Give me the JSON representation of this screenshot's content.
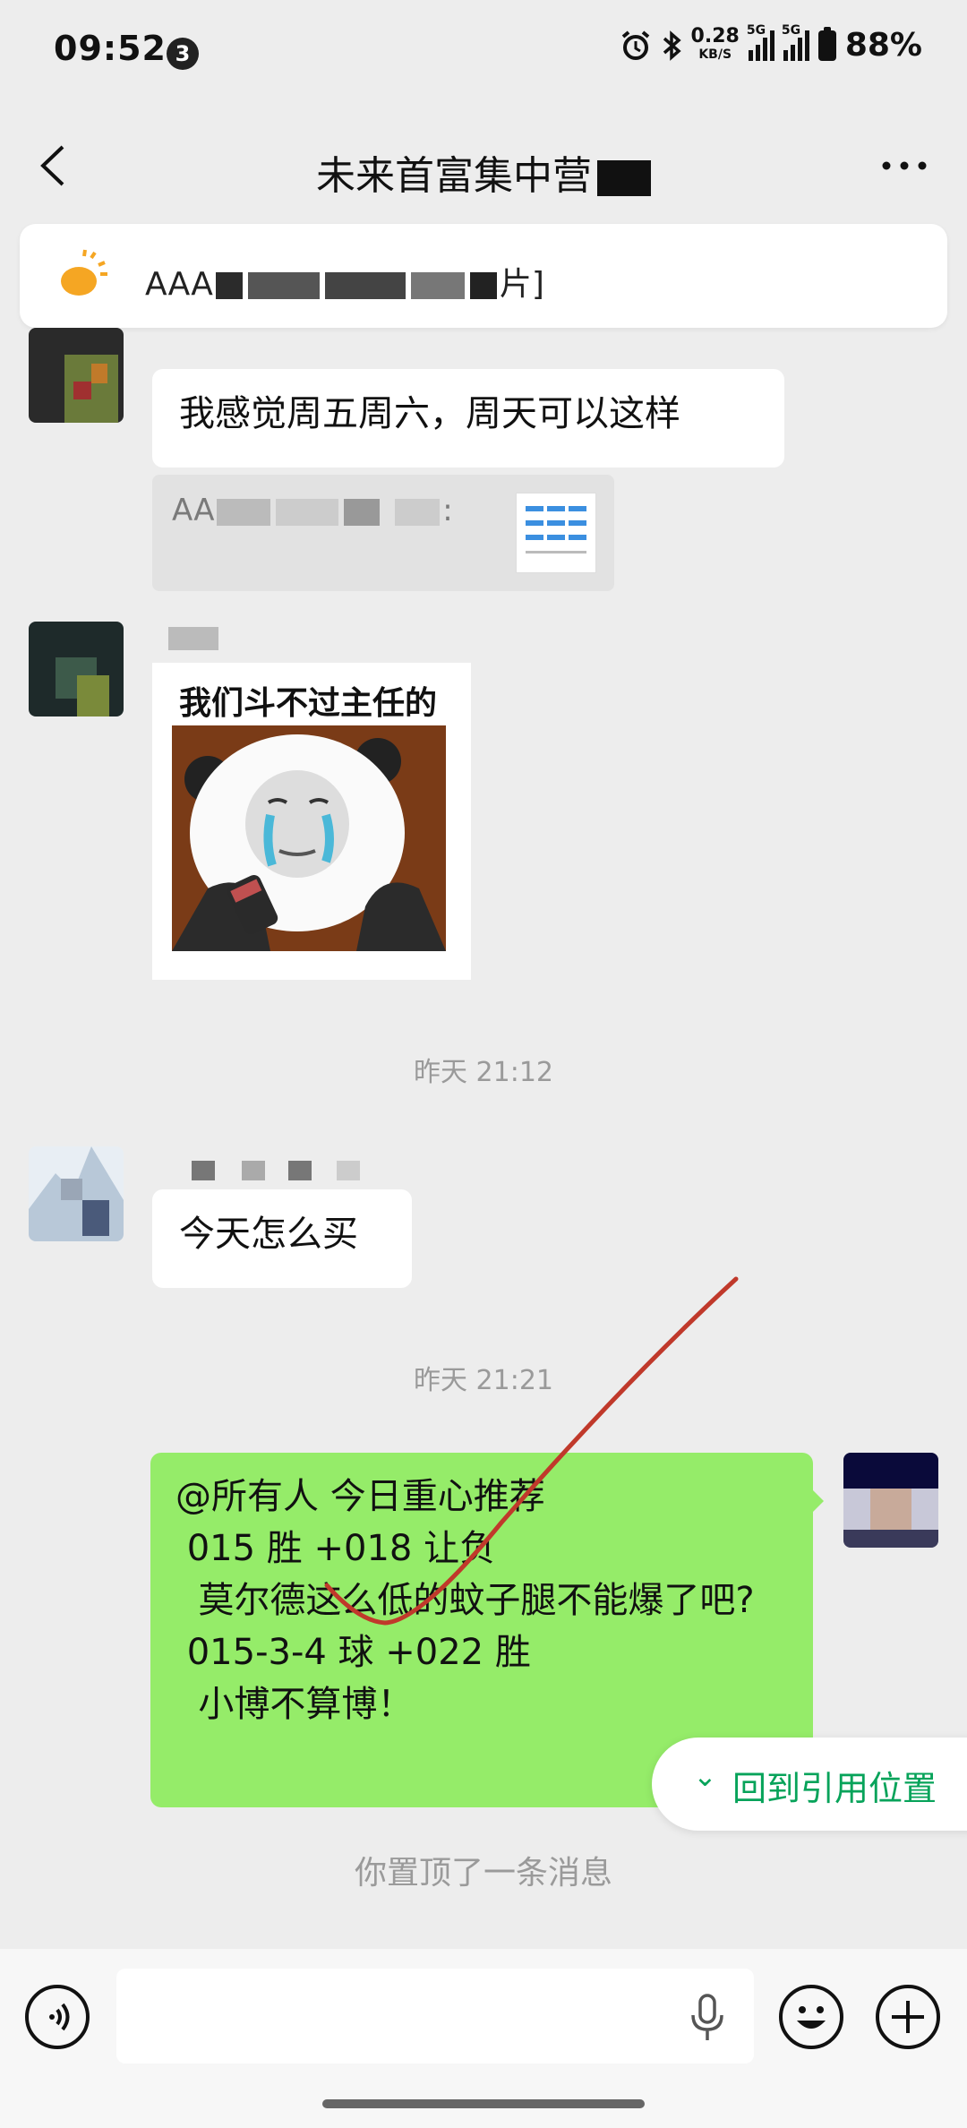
{
  "status_bar": {
    "time": "09:52",
    "notif_count": "3",
    "speed": "0.28",
    "speed_unit": "KB/S",
    "net1": "5G",
    "net2": "5G",
    "battery": "88%"
  },
  "header": {
    "title": "未来首富集中营"
  },
  "pinned": {
    "text_start": "AAA",
    "text_end": "片]"
  },
  "messages": {
    "m1": {
      "text": "我感觉周五周六，周天可以这样"
    },
    "quote": {
      "text": "AA"
    },
    "sticker": {
      "caption": "我们斗不过主任的"
    },
    "ts1": "昨天 21:12",
    "m3": {
      "text": "今天怎么买"
    },
    "ts2": "昨天 21:21",
    "mine": {
      "line1": "@所有人  今日重心推荐",
      "line2": " 015 胜 +018 让负",
      "line3": "  莫尔德这么低的蚊子腿不能爆了吧?",
      "line4": " 015-3-4 球 +022 胜",
      "line5": "  小博不算博！"
    },
    "back_to_quote": "回到引用位置",
    "system": "你置顶了一条消息"
  },
  "colors": {
    "my_bubble": "#95ec69",
    "accent": "#07a35a",
    "bg": "#ededed"
  },
  "icons": [
    "back-icon",
    "more-icon",
    "sun-icon",
    "voice-icon",
    "mic-icon",
    "emoji-icon",
    "plus-icon"
  ]
}
